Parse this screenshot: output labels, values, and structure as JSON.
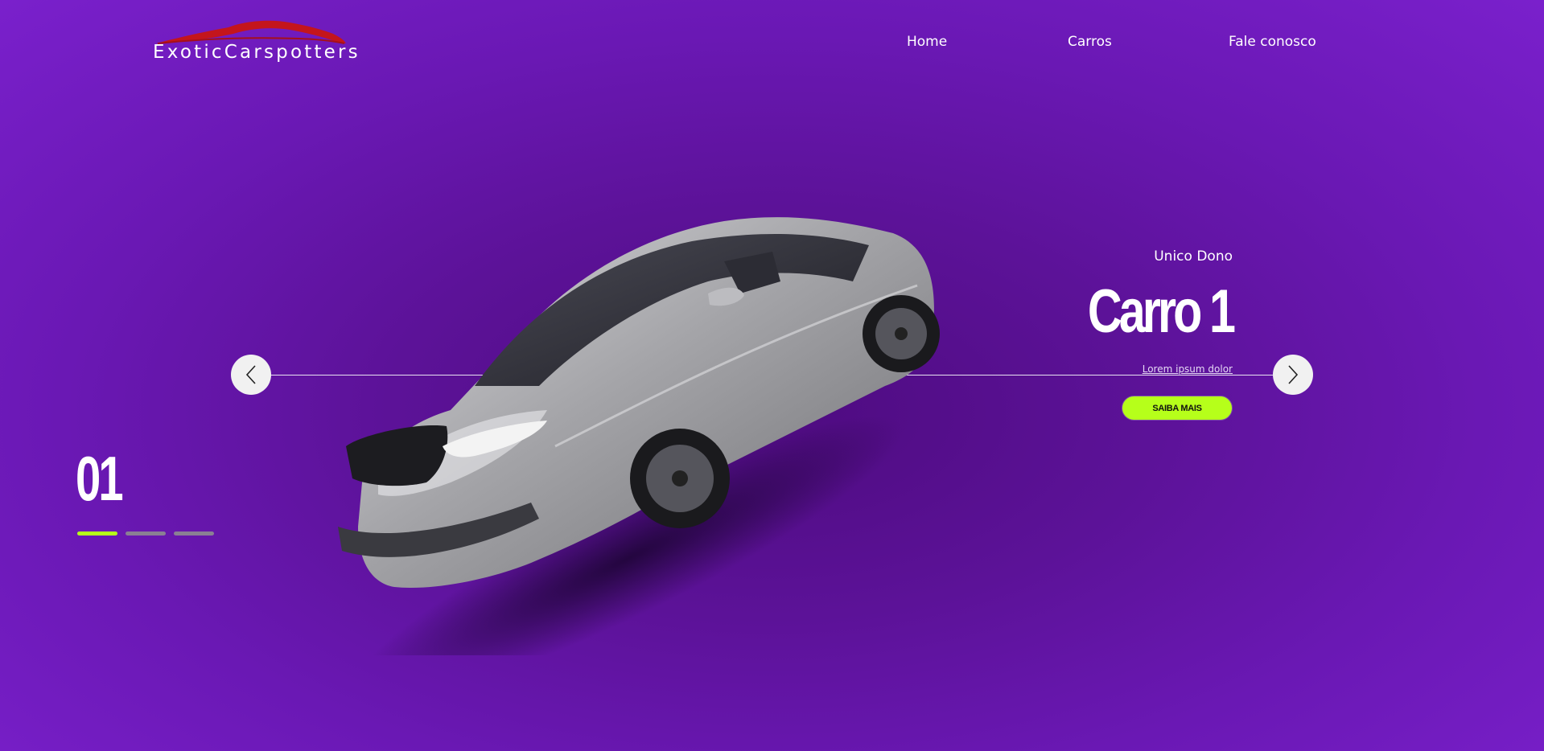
{
  "header": {
    "logo_text": "ExoticCarspotters",
    "nav": [
      {
        "label": "Home"
      },
      {
        "label": "Carros"
      },
      {
        "label": "Fale conosco"
      }
    ]
  },
  "slide": {
    "subtitle": "Unico Dono",
    "title": "Carro 1",
    "description": "Lorem ipsum dolor",
    "cta_label": "SAIBA MAIS",
    "counter": "01",
    "active_index": 1,
    "total": 3
  },
  "icons": {
    "prev": "chevron-left-icon",
    "next": "chevron-right-icon"
  },
  "colors": {
    "accent": "#b6ff1a",
    "background": "#6a18b4",
    "logo_swoosh": "#c4151c",
    "inactive_dot": "#8a7f93"
  }
}
